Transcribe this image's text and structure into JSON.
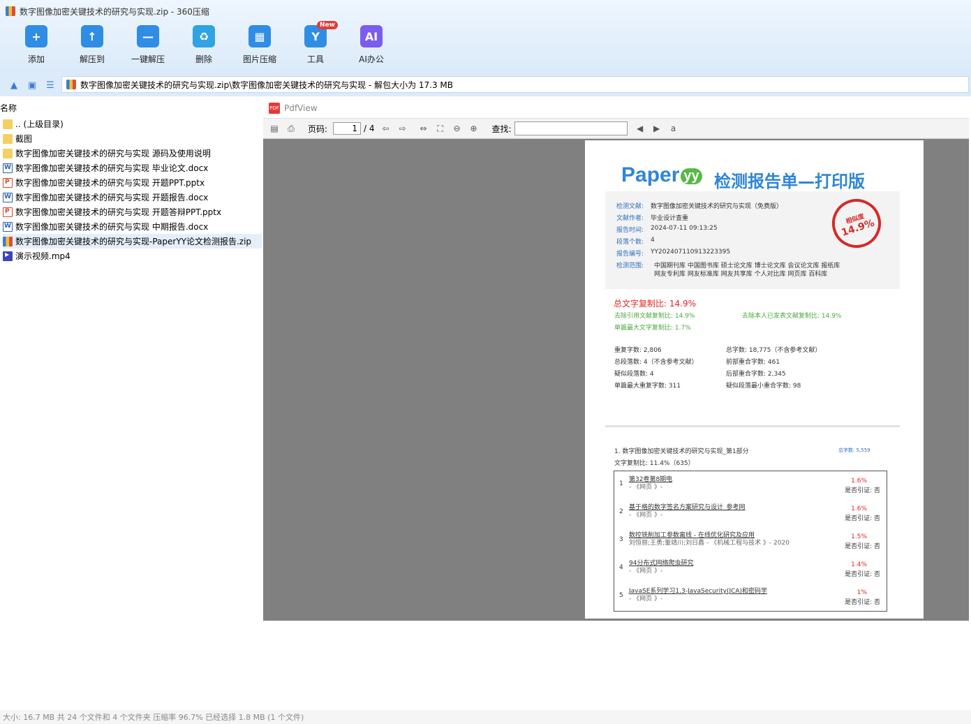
{
  "window": {
    "title": "数字图像加密关键技术的研究与实现.zip - 360压缩"
  },
  "toolbar": {
    "buttons": [
      {
        "label": "添加",
        "icon": "add-icon",
        "color": "#2f8de4"
      },
      {
        "label": "解压到",
        "icon": "extract-to-icon",
        "color": "#2f8de4"
      },
      {
        "label": "一键解压",
        "icon": "one-click-extract-icon",
        "color": "#2f8de4"
      },
      {
        "label": "删除",
        "icon": "trash-icon",
        "color": "#2fa3e4"
      },
      {
        "label": "图片压缩",
        "icon": "image-compress-icon",
        "color": "#2f8de4"
      },
      {
        "label": "工具",
        "icon": "tools-icon",
        "color": "#2f8de4",
        "badge": "New"
      },
      {
        "label": "AI办公",
        "icon": "ai-icon",
        "color": "#7b5cf0"
      }
    ]
  },
  "address": {
    "path": "数字图像加密关键技术的研究与实现.zip\\数字图像加密关键技术的研究与实现 - 解包大小为 17.3 MB"
  },
  "filelist": {
    "header": "名称",
    "items": [
      {
        "name": ".. (上级目录)",
        "type": "folder"
      },
      {
        "name": "截图",
        "type": "folder"
      },
      {
        "name": "数字图像加密关键技术的研究与实现 源码及使用说明",
        "type": "folder"
      },
      {
        "name": "数字图像加密关键技术的研究与实现 毕业论文.docx",
        "type": "docx"
      },
      {
        "name": "数字图像加密关键技术的研究与实现 开题PPT.pptx",
        "type": "pptx"
      },
      {
        "name": "数字图像加密关键技术的研究与实现 开题报告.docx",
        "type": "docx"
      },
      {
        "name": "数字图像加密关键技术的研究与实现 开题答辩PPT.pptx",
        "type": "pptx"
      },
      {
        "name": "数字图像加密关键技术的研究与实现 中期报告.docx",
        "type": "docx"
      },
      {
        "name": "数字图像加密关键技术的研究与实现-PaperYY论文检测报告.zip",
        "type": "zip",
        "selected": true
      },
      {
        "name": "演示视频.mp4",
        "type": "mp4"
      }
    ]
  },
  "pdfview": {
    "title": "PdfView",
    "page_label": "页码:",
    "page_current": "1",
    "page_total": "/ 4",
    "find_label": "查找:"
  },
  "report": {
    "brand": "Paper",
    "brand_mark": "yy",
    "heading": "检测报告单—打印版",
    "info": [
      {
        "k": "检测文献:",
        "v": "数字图像加密关键技术的研究与实现（免费版）"
      },
      {
        "k": "文献作者:",
        "v": "毕业设计查重"
      },
      {
        "k": "报告时间:",
        "v": "2024-07-11 09:13:25"
      },
      {
        "k": "段落个数:",
        "v": "4"
      },
      {
        "k": "报告编号:",
        "v": "YY202407110913223395"
      }
    ],
    "scope_label": "检测范围:",
    "scope_line1": "中国期刊库  中国图书库  硕士论文库  博士论文库  会议论文库  报纸库",
    "scope_line2": "网友专利库  网友标准库  网友共享库  个人对比库  网页库  百科库",
    "stamp_top": "相似度",
    "stamp_value": "14.9%",
    "total_ratio": "总文字复制比: 14.9%",
    "ratio_a": "去除引用文献复制比: 14.9%",
    "ratio_b": "去除本人已发表文献复制比: 14.9%",
    "ratio_c": "单篇最大文字复制比: 1.7%",
    "stats": [
      "重复字数: 2,806",
      "总字数: 18,775（不含参考文献）",
      "总段落数: 4（不含参考文献）",
      "前部重合字数: 461",
      "疑似段落数: 4",
      "后部重合字数: 2,345",
      "单篇最大重复字数: 311",
      "疑似段落最小重合字数: 98"
    ],
    "section_title": "1. 数字图像加密关键技术的研究与实现_第1部分",
    "section_chars": "总字数: 5,559",
    "section_ratio": "文字复制比: 11.4%（635）",
    "sources": [
      {
        "n": "1",
        "title": "第32卷第8期电",
        "sub": "- 《网页 》-",
        "pct": "1.6%",
        "cite": "是否引证: 否"
      },
      {
        "n": "2",
        "title": "基于格的数字签名方案研究与设计_参考网",
        "sub": "- 《网页 》-",
        "pct": "1.6%",
        "cite": "是否引证: 否"
      },
      {
        "n": "3",
        "title": "数控铣削加工参数离线 - 在线优化研究及应用",
        "sub": "刘恒丽;王勇;董靖川;刘日鑫 - 《机械工程与技术 》- 2020",
        "pct": "1.5%",
        "cite": "是否引证: 否"
      },
      {
        "n": "4",
        "title": "94分布式网络爬虫研究",
        "sub": "- 《网页 》-",
        "pct": "1.4%",
        "cite": "是否引证: 否"
      },
      {
        "n": "5",
        "title": "JavaSE系列学习1.3-JavaSecurity(JCA)和密码学",
        "sub": "- 《网页 》-",
        "pct": "1%",
        "cite": "是否引证: 否"
      }
    ]
  },
  "status": {
    "text": "大小: 16.7 MB 共 24 个文件和 4 个文件夹 压缩率 96.7% 已经选择 1.8 MB (1 个文件)"
  }
}
